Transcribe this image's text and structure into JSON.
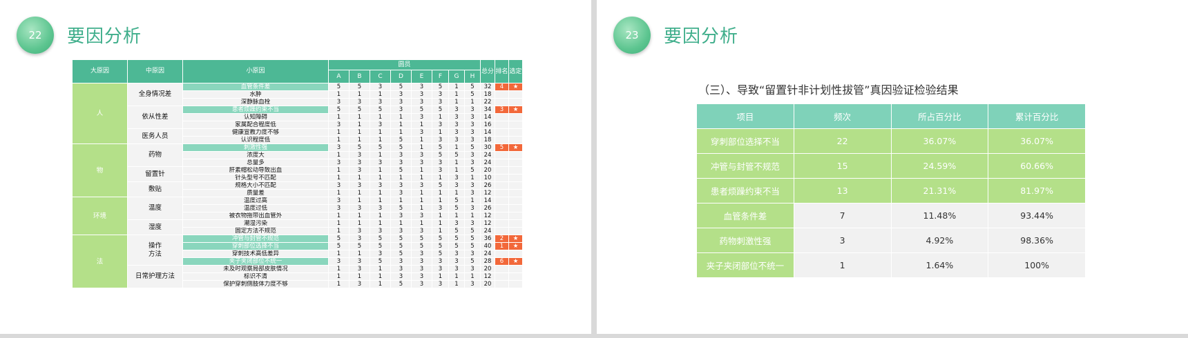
{
  "slide1": {
    "number": "22",
    "title": "要因分析",
    "table": {
      "headers": {
        "major": "大原因",
        "mid": "中原因",
        "minor": "小原因",
        "members": "圆员",
        "total": "总分",
        "rank": "排名",
        "select": "选定"
      },
      "member_cols": [
        "A",
        "B",
        "C",
        "D",
        "E",
        "F",
        "G",
        "H"
      ],
      "groups": [
        {
          "major": "人",
          "mids": [
            {
              "label": "全身情况差",
              "rows": [
                {
                  "minor": "血管条件差",
                  "scores": [
                    "5",
                    "5",
                    "3",
                    "5",
                    "3",
                    "5",
                    "1",
                    "5"
                  ],
                  "total": "32",
                  "rank": "4",
                  "select": "★",
                  "highlight": true
                },
                {
                  "minor": "水肿",
                  "scores": [
                    "1",
                    "1",
                    "1",
                    "3",
                    "3",
                    "3",
                    "1",
                    "5"
                  ],
                  "total": "18",
                  "rank": "",
                  "select": "",
                  "highlight": false
                },
                {
                  "minor": "深静脉血栓",
                  "scores": [
                    "3",
                    "3",
                    "3",
                    "3",
                    "3",
                    "3",
                    "1",
                    "1"
                  ],
                  "total": "22",
                  "rank": "",
                  "select": "",
                  "highlight": false
                }
              ]
            },
            {
              "label": "依从性差",
              "rows": [
                {
                  "minor": "患者烦躁约束不当",
                  "scores": [
                    "5",
                    "5",
                    "5",
                    "3",
                    "5",
                    "5",
                    "3",
                    "3"
                  ],
                  "total": "34",
                  "rank": "3",
                  "select": "★",
                  "highlight": true
                },
                {
                  "minor": "认知障碍",
                  "scores": [
                    "1",
                    "1",
                    "1",
                    "1",
                    "3",
                    "1",
                    "3",
                    "3"
                  ],
                  "total": "14",
                  "rank": "",
                  "select": "",
                  "highlight": false
                },
                {
                  "minor": "家属配合程度低",
                  "scores": [
                    "3",
                    "1",
                    "3",
                    "1",
                    "1",
                    "3",
                    "3",
                    "3"
                  ],
                  "total": "16",
                  "rank": "",
                  "select": "",
                  "highlight": false
                }
              ]
            },
            {
              "label": "医务人员",
              "rows": [
                {
                  "minor": "健康宣教力度不够",
                  "scores": [
                    "1",
                    "1",
                    "1",
                    "1",
                    "3",
                    "1",
                    "3",
                    "3"
                  ],
                  "total": "14",
                  "rank": "",
                  "select": "",
                  "highlight": false
                },
                {
                  "minor": "认识程度低",
                  "scores": [
                    "1",
                    "1",
                    "1",
                    "5",
                    "1",
                    "3",
                    "3",
                    "3"
                  ],
                  "total": "18",
                  "rank": "",
                  "select": "",
                  "highlight": false
                }
              ]
            }
          ]
        },
        {
          "major": "物",
          "mids": [
            {
              "label": "药物",
              "rows": [
                {
                  "minor": "刺激性强",
                  "scores": [
                    "3",
                    "5",
                    "5",
                    "5",
                    "1",
                    "5",
                    "1",
                    "5"
                  ],
                  "total": "30",
                  "rank": "5",
                  "select": "★",
                  "highlight": true
                },
                {
                  "minor": "浓度大",
                  "scores": [
                    "1",
                    "3",
                    "1",
                    "3",
                    "3",
                    "5",
                    "5",
                    "3"
                  ],
                  "total": "24",
                  "rank": "",
                  "select": "",
                  "highlight": false
                },
                {
                  "minor": "总量多",
                  "scores": [
                    "3",
                    "3",
                    "3",
                    "3",
                    "3",
                    "3",
                    "1",
                    "3"
                  ],
                  "total": "24",
                  "rank": "",
                  "select": "",
                  "highlight": false
                }
              ]
            },
            {
              "label": "留置针",
              "rows": [
                {
                  "minor": "肝素帽松动导致出血",
                  "scores": [
                    "1",
                    "3",
                    "1",
                    "5",
                    "1",
                    "3",
                    "1",
                    "5"
                  ],
                  "total": "20",
                  "rank": "",
                  "select": "",
                  "highlight": false
                },
                {
                  "minor": "针头型号不匹配",
                  "scores": [
                    "1",
                    "1",
                    "1",
                    "1",
                    "1",
                    "1",
                    "3",
                    "1"
                  ],
                  "total": "10",
                  "rank": "",
                  "select": "",
                  "highlight": false
                }
              ]
            },
            {
              "label": "敷贴",
              "rows": [
                {
                  "minor": "规格大小不匹配",
                  "scores": [
                    "3",
                    "3",
                    "3",
                    "3",
                    "3",
                    "5",
                    "3",
                    "3"
                  ],
                  "total": "26",
                  "rank": "",
                  "select": "",
                  "highlight": false
                },
                {
                  "minor": "质量差",
                  "scores": [
                    "1",
                    "1",
                    "1",
                    "3",
                    "1",
                    "1",
                    "1",
                    "3"
                  ],
                  "total": "12",
                  "rank": "",
                  "select": "",
                  "highlight": false
                }
              ]
            }
          ]
        },
        {
          "major": "环境",
          "mids": [
            {
              "label": "温度",
              "rows": [
                {
                  "minor": "温度过高",
                  "scores": [
                    "3",
                    "1",
                    "1",
                    "1",
                    "1",
                    "1",
                    "5",
                    "1"
                  ],
                  "total": "14",
                  "rank": "",
                  "select": "",
                  "highlight": false
                },
                {
                  "minor": "温度过低",
                  "scores": [
                    "3",
                    "3",
                    "3",
                    "5",
                    "1",
                    "3",
                    "5",
                    "3"
                  ],
                  "total": "26",
                  "rank": "",
                  "select": "",
                  "highlight": false
                },
                {
                  "minor": "被衣物拖带出血管外",
                  "scores": [
                    "1",
                    "1",
                    "1",
                    "3",
                    "3",
                    "1",
                    "1",
                    "1"
                  ],
                  "total": "12",
                  "rank": "",
                  "select": "",
                  "highlight": false
                }
              ]
            },
            {
              "label": "湿度",
              "rows": [
                {
                  "minor": "潮湿污染",
                  "scores": [
                    "1",
                    "1",
                    "1",
                    "1",
                    "1",
                    "1",
                    "3",
                    "3"
                  ],
                  "total": "12",
                  "rank": "",
                  "select": "",
                  "highlight": false
                },
                {
                  "minor": "固定方法不规范",
                  "scores": [
                    "1",
                    "3",
                    "3",
                    "3",
                    "3",
                    "1",
                    "5",
                    "5"
                  ],
                  "total": "24",
                  "rank": "",
                  "select": "",
                  "highlight": false
                }
              ]
            }
          ]
        },
        {
          "major": "法",
          "mids": [
            {
              "label": "操作\n方法",
              "rows": [
                {
                  "minor": "冲管与封管不规范",
                  "scores": [
                    "5",
                    "3",
                    "5",
                    "5",
                    "5",
                    "5",
                    "5",
                    "5"
                  ],
                  "total": "36",
                  "rank": "2",
                  "select": "★",
                  "highlight": true
                },
                {
                  "minor": "穿刺部位选择不当",
                  "scores": [
                    "5",
                    "5",
                    "5",
                    "5",
                    "5",
                    "5",
                    "5",
                    "5"
                  ],
                  "total": "40",
                  "rank": "1",
                  "select": "★",
                  "highlight": true
                },
                {
                  "minor": "穿刺技术高低差异",
                  "scores": [
                    "1",
                    "1",
                    "3",
                    "5",
                    "3",
                    "5",
                    "3",
                    "3"
                  ],
                  "total": "24",
                  "rank": "",
                  "select": "",
                  "highlight": false
                },
                {
                  "minor": "夹子夹闭部位不统一",
                  "scores": [
                    "3",
                    "3",
                    "5",
                    "3",
                    "3",
                    "3",
                    "3",
                    "5"
                  ],
                  "total": "28",
                  "rank": "6",
                  "select": "★",
                  "highlight": true
                }
              ]
            },
            {
              "label": "日常护理方法",
              "rows": [
                {
                  "minor": "未及时观察局部皮肤情况",
                  "scores": [
                    "1",
                    "3",
                    "1",
                    "3",
                    "3",
                    "3",
                    "3",
                    "3"
                  ],
                  "total": "20",
                  "rank": "",
                  "select": "",
                  "highlight": false
                },
                {
                  "minor": "标识不清",
                  "scores": [
                    "1",
                    "1",
                    "1",
                    "3",
                    "3",
                    "1",
                    "1",
                    "1"
                  ],
                  "total": "12",
                  "rank": "",
                  "select": "",
                  "highlight": false
                },
                {
                  "minor": "保护穿刺侧肢体力度不够",
                  "scores": [
                    "1",
                    "3",
                    "1",
                    "5",
                    "3",
                    "3",
                    "1",
                    "3"
                  ],
                  "total": "20",
                  "rank": "",
                  "select": "",
                  "highlight": false
                }
              ]
            }
          ]
        }
      ]
    }
  },
  "slide2": {
    "number": "23",
    "title": "要因分析",
    "subtitle": "（三）、导致“留置针非计划性拔管”真因验证检验结果",
    "table": {
      "headers": [
        "项目",
        "频次",
        "所占百分比",
        "累计百分比"
      ],
      "rows": [
        {
          "item": "穿刺部位选择不当",
          "freq": "22",
          "pct": "36.07%",
          "cum": "36.07%",
          "style": "green"
        },
        {
          "item": "冲管与封管不规范",
          "freq": "15",
          "pct": "24.59%",
          "cum": "60.66%",
          "style": "green"
        },
        {
          "item": "患者烦躁约束不当",
          "freq": "13",
          "pct": "21.31%",
          "cum": "81.97%",
          "style": "green"
        },
        {
          "item": "血管条件差",
          "freq": "7",
          "pct": "11.48%",
          "cum": "93.44%",
          "style": "grey"
        },
        {
          "item": "药物刺激性强",
          "freq": "3",
          "pct": "4.92%",
          "cum": "98.36%",
          "style": "grey"
        },
        {
          "item": "夹子夹闭部位不统一",
          "freq": "1",
          "pct": "1.64%",
          "cum": "100%",
          "style": "grey"
        }
      ]
    }
  },
  "colors": {
    "title": "#3fae8b",
    "header": "#4db895",
    "category_green": "#b4e089",
    "highlight_teal": "#8ad6bd",
    "rank_orange": "#f2683a"
  }
}
